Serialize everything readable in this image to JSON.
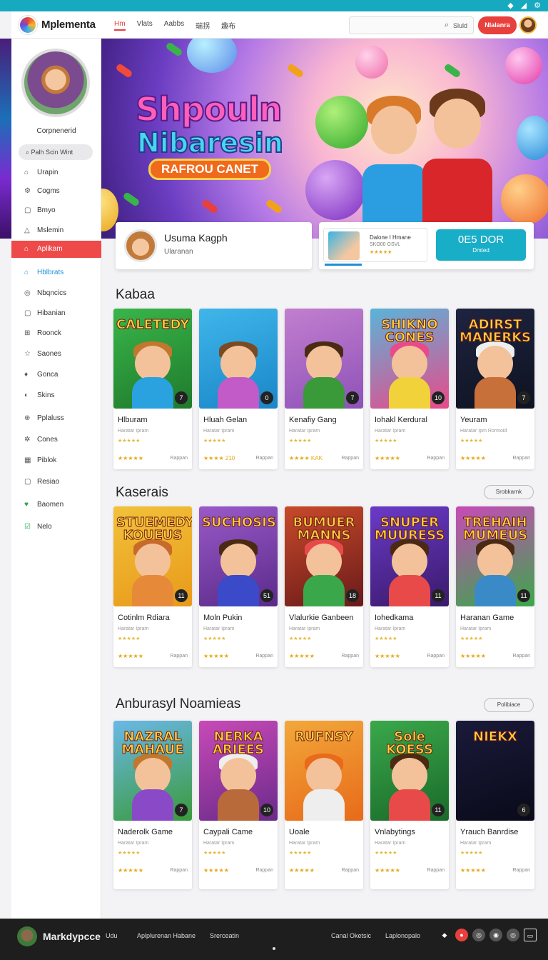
{
  "statusbar": {
    "icons": [
      "wifi-icon",
      "signal-icon",
      "settings-icon"
    ]
  },
  "header": {
    "brand": "Mplementa",
    "nav": [
      "Hm",
      "Vlats",
      "Aabbs",
      "瑞拐",
      "趣布"
    ],
    "search_text": "Sluld",
    "signup_label": "Nlalanra"
  },
  "sidebar": {
    "profile_name": "Corpnenerid",
    "search_label": "Palh Scin Wint",
    "items": [
      {
        "label": "Urapin",
        "icon": "home-icon"
      },
      {
        "label": "Cogms",
        "icon": "gear-icon"
      },
      {
        "label": "Bmyo",
        "icon": "box-icon"
      },
      {
        "label": "Mslemin",
        "icon": "warning-icon"
      },
      {
        "label": "Aplikam",
        "icon": "shield-icon"
      },
      {
        "label": "Hblbrats",
        "icon": "home-icon"
      },
      {
        "label": "Nbqncics",
        "icon": "pin-icon"
      },
      {
        "label": "Hibanian",
        "icon": "box-icon"
      },
      {
        "label": "Roonck",
        "icon": "grid-icon"
      },
      {
        "label": "Saones",
        "icon": "star-icon"
      },
      {
        "label": "Gonca",
        "icon": "tag-icon"
      },
      {
        "label": "Skins",
        "icon": "palette-icon"
      },
      {
        "label": "Pplaluss",
        "icon": "plus-icon"
      },
      {
        "label": "Cones",
        "icon": "sparkle-icon"
      },
      {
        "label": "Piblok",
        "icon": "grid-icon"
      },
      {
        "label": "Resiao",
        "icon": "box-icon"
      },
      {
        "label": "Baomen",
        "icon": "heart-icon"
      },
      {
        "label": "Nelo",
        "icon": "check-icon"
      }
    ]
  },
  "hero": {
    "title_line1": "Shpouln",
    "title_line2": "Nibaresin",
    "ribbon": "RAFROU CANET"
  },
  "featured_user": {
    "name": "Usuma Kagph",
    "subtitle": "Ularanan"
  },
  "featured_game": {
    "title": "Dalone I Hmane",
    "meta": "SKO00 GSVL",
    "stars": "★★★★★",
    "price": "0E5 DOR",
    "price_sub": "Dmted"
  },
  "sections": [
    {
      "title": "Kabaa",
      "button": "",
      "games": [
        {
          "art_title": "CALETEDY",
          "title": "Hlburam",
          "sub": "Haratar Ipram",
          "stars_top": "★★★★★",
          "stars": "★★★★★",
          "action": "Rappan",
          "badge": "7",
          "colors": [
            "#39b54a",
            "#1f7a2c"
          ],
          "body": "#2aa2e0",
          "hair": "#c2772e"
        },
        {
          "art_title": "",
          "title": "Hluah Gelan",
          "sub": "Haratar Ipram",
          "stars_top": "★★★★★",
          "stars": "★★★★ 210",
          "action": "Rappan",
          "badge": "0",
          "colors": [
            "#3fb6ea",
            "#1a86c8"
          ],
          "body": "#c25ac8",
          "hair": "#7a4a22"
        },
        {
          "art_title": "",
          "title": "Kenafiy Gang",
          "sub": "Haratar Ipram",
          "stars_top": "★★★★★",
          "stars": "★★★★ KAK",
          "action": "Rappan",
          "badge": "7",
          "colors": [
            "#c27fcf",
            "#8e52b8"
          ],
          "body": "#3a9a3a",
          "hair": "#4a2a12"
        },
        {
          "art_title": "SHIKNO CONES",
          "title": "Iohakl Kerdural",
          "sub": "Haratar Ipram",
          "stars_top": "★★★★★",
          "stars": "★★★★★",
          "action": "Rappan",
          "badge": "10",
          "colors": [
            "#5ab4d8",
            "#e84a8a"
          ],
          "body": "#f2d23a",
          "hair": "#e84a8a"
        },
        {
          "art_title": "ADIRST MANERKS",
          "title": "Yeuram",
          "sub": "Haratar Ipm Rormoid",
          "stars_top": "★★★★★",
          "stars": "★★★★★",
          "action": "Rappan",
          "badge": "7",
          "colors": [
            "#1e2440",
            "#0e1220"
          ],
          "body": "#c8703a",
          "hair": "#eee"
        }
      ]
    },
    {
      "title": "Kaserais",
      "button": "Srobkarnk",
      "games": [
        {
          "art_title": "STUEMEDY KOUEUS",
          "title": "Cotinlm Rdiara",
          "sub": "Haratar Ipram",
          "stars_top": "★★★★★",
          "stars": "★★★★★",
          "action": "Rappan",
          "badge": "11",
          "colors": [
            "#f2c13a",
            "#e89a1a"
          ],
          "body": "#e68a3a",
          "hair": "#c86a2a"
        },
        {
          "art_title": "SUCHOSIS",
          "title": "Moln Pukin",
          "sub": "Haratar Ipram",
          "stars_top": "★★★★★",
          "stars": "★★★★★",
          "action": "Rappan",
          "badge": "51",
          "colors": [
            "#9a5ac8",
            "#5a2a8a"
          ],
          "body": "#3a4ac8",
          "hair": "#4a2a12"
        },
        {
          "art_title": "BUMUER MANNS",
          "title": "Vlalurkie Ganbeen",
          "sub": "Haratar Ipram",
          "stars_top": "★★★★★",
          "stars": "★★★★★",
          "action": "Rappan",
          "badge": "18",
          "colors": [
            "#c84a2a",
            "#6a1a1a"
          ],
          "body": "#3aa84a",
          "hair": "#e84a4a"
        },
        {
          "art_title": "SNUPER MUURESS",
          "title": "Iohedkama",
          "sub": "Haratar Ipram",
          "stars_top": "★★★★★",
          "stars": "★★★★★",
          "action": "Rappan",
          "badge": "11",
          "colors": [
            "#6a3ac8",
            "#3a1a6a"
          ],
          "body": "#e84a4a",
          "hair": "#4a2a12"
        },
        {
          "art_title": "TREHAIH MUMEUS",
          "title": "Haranan Game",
          "sub": "Haratar Ipram",
          "stars_top": "★★★★★",
          "stars": "★★★★★",
          "action": "Rappan",
          "badge": "11",
          "colors": [
            "#c84ab8",
            "#3aa84a"
          ],
          "body": "#3a8ac8",
          "hair": "#4a2a12"
        }
      ]
    },
    {
      "title": "Anburasyl Noamieas",
      "button": "Polibiace",
      "games": [
        {
          "art_title": "NAZRAL MAHAUE",
          "title": "Naderolk Game",
          "sub": "Haratar Ipram",
          "stars_top": "★★★★★",
          "stars": "★★★★★",
          "action": "Rappan",
          "badge": "7",
          "colors": [
            "#6ab8e8",
            "#3a9a3a"
          ],
          "body": "#8a4ac8",
          "hair": "#c2772e"
        },
        {
          "art_title": "NERKA ARIEES",
          "title": "Caypali Came",
          "sub": "Haratar Ipram",
          "stars_top": "★★★★★",
          "stars": "★★★★★",
          "action": "Rappan",
          "badge": "10",
          "colors": [
            "#c84ab8",
            "#6a2a8a"
          ],
          "body": "#b86a3a",
          "hair": "#eee"
        },
        {
          "art_title": "RUFNSY",
          "title": "Uoale",
          "sub": "Haratar Ipram",
          "stars_top": "★★★★★",
          "stars": "★★★★★",
          "action": "Rappan",
          "badge": "",
          "colors": [
            "#f2a83a",
            "#e86a1a"
          ],
          "body": "#eee",
          "hair": "#e86a1a"
        },
        {
          "art_title": "Sole KOESS",
          "title": "Vnlabytings",
          "sub": "Haratar Ipram",
          "stars_top": "★★★★★",
          "stars": "★★★★★",
          "action": "Rappan",
          "badge": "11",
          "colors": [
            "#3aa84a",
            "#1a6a2a"
          ],
          "body": "#e84a4a",
          "hair": "#4a2a12"
        },
        {
          "art_title": "NIEKX",
          "title": "Yrauch Banrdise",
          "sub": "Haratar Ipram",
          "stars_top": "★★★★★",
          "stars": "★★★★★",
          "action": "Rappan",
          "badge": "6",
          "colors": [
            "#1a1a3a",
            "#0a0a1a"
          ],
          "body": "",
          "hair": ""
        }
      ]
    }
  ],
  "bottombar": {
    "name": "Markdypcce",
    "links": [
      "Udu",
      "Aplplurenan Habane",
      "Srerceatin",
      "Canal Oketsic",
      "Laplonopalo"
    ]
  },
  "colors": {
    "accent": "#e8403c",
    "brand_teal": "#19aec8",
    "link_blue": "#1f8fd6"
  }
}
